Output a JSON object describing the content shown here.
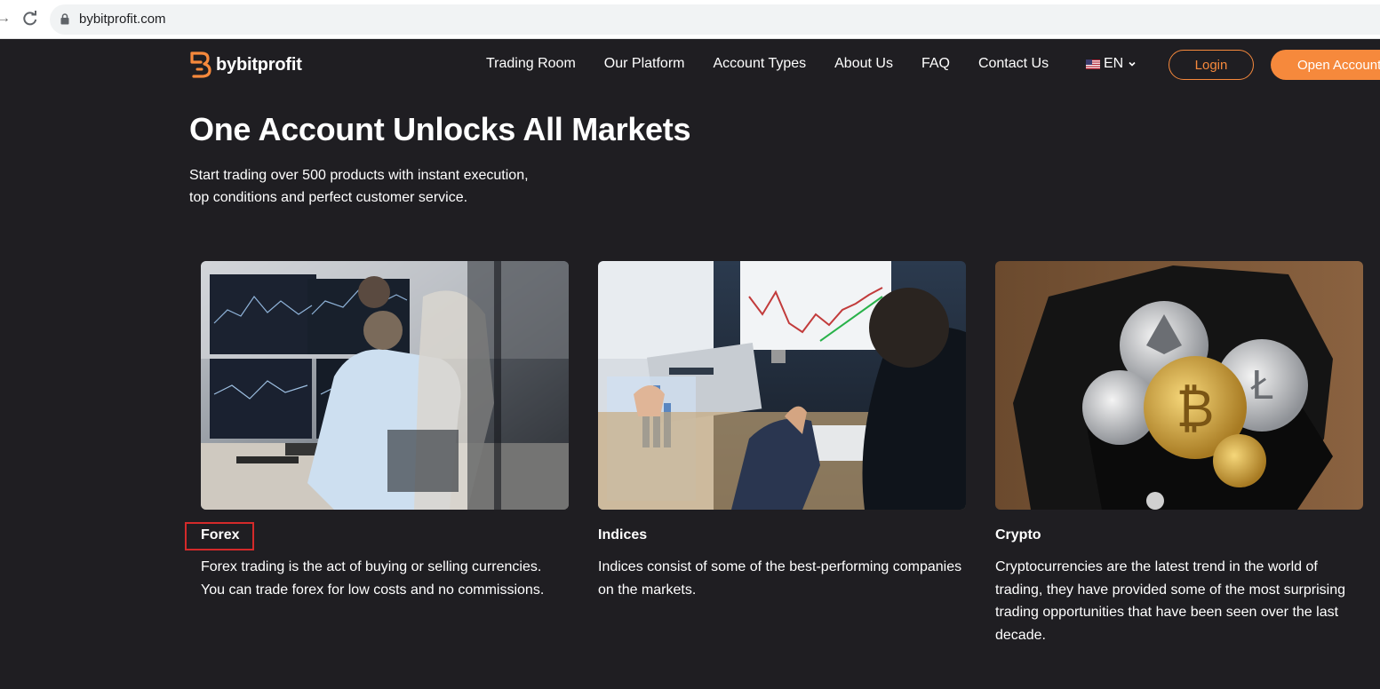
{
  "browser": {
    "url": "bybitprofit.com"
  },
  "header": {
    "brand": "bybitprofit",
    "nav": [
      "Trading Room",
      "Our Platform",
      "Account Types",
      "About Us",
      "FAQ",
      "Contact Us"
    ],
    "language": "EN",
    "login_label": "Login",
    "open_account_label": "Open Account"
  },
  "hero": {
    "title": "One Account Unlocks All Markets",
    "subtitle_line1": "Start trading over 500 products with instant execution,",
    "subtitle_line2": "top conditions and perfect customer service."
  },
  "cards": [
    {
      "title": "Forex",
      "description": "Forex trading is the act of buying or selling currencies. You can trade forex for low costs and no commissions."
    },
    {
      "title": "Indices",
      "description": "Indices consist of some of the best-performing companies on the markets."
    },
    {
      "title": "Crypto",
      "description": "Cryptocurrencies are the latest trend in the world of trading, they have provided some of the most surprising trading opportunities that have been seen over the last decade."
    }
  ],
  "colors": {
    "accent": "#f6893c",
    "background": "#1f1e22",
    "highlight_box": "#d42a2a"
  },
  "icons": [
    "back-arrow-icon",
    "reload-icon",
    "lock-icon",
    "logo-icon",
    "us-flag-icon",
    "chevron-down-icon"
  ]
}
